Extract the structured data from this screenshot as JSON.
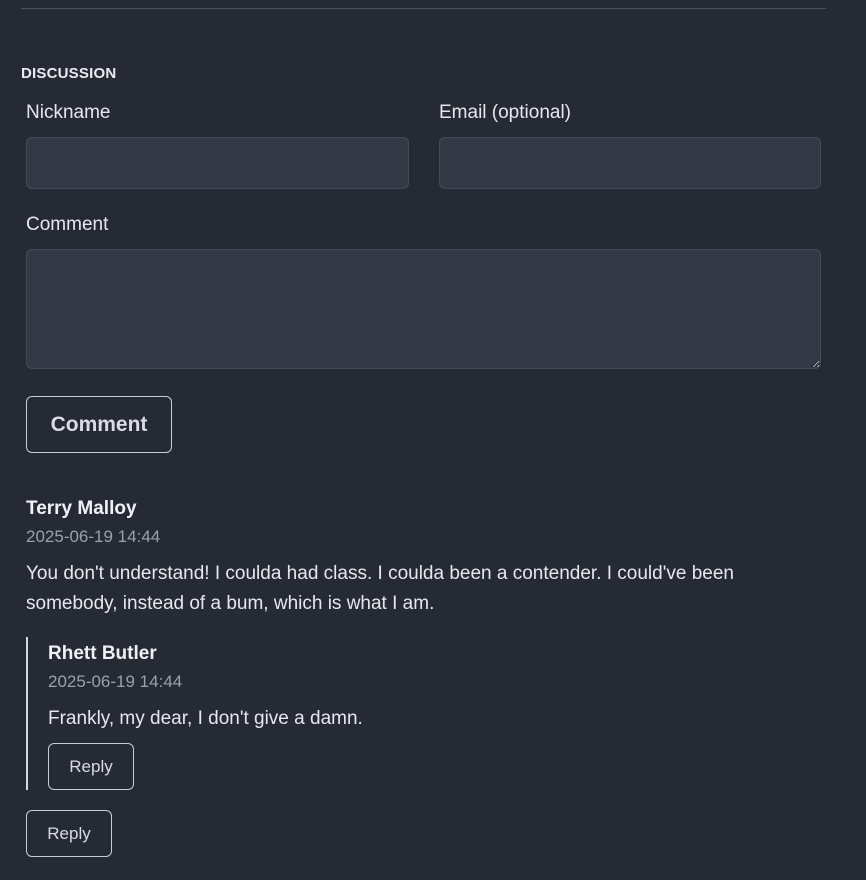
{
  "discussion": {
    "title": "DISCUSSION"
  },
  "form": {
    "nickname_label": "Nickname",
    "nickname_value": "",
    "nickname_placeholder": "",
    "email_label": "Email (optional)",
    "email_value": "",
    "email_placeholder": "",
    "comment_label": "Comment",
    "comment_value": "",
    "comment_placeholder": "",
    "submit_label": "Comment"
  },
  "comments": [
    {
      "author": "Terry Malloy",
      "timestamp": "2025-06-19 14:44",
      "text": "You don't understand! I coulda had class. I coulda been a contender. I could've been somebody, instead of a bum, which is what I am.",
      "reply_label": "Reply",
      "replies": [
        {
          "author": "Rhett Butler",
          "timestamp": "2025-06-19 14:44",
          "text": "Frankly, my dear, I don't give a damn.",
          "reply_label": "Reply"
        }
      ]
    }
  ],
  "colors": {
    "background": "#262a35",
    "input_background": "#343947",
    "text": "#e6e8ec",
    "muted_text": "#9aa0ac",
    "button_border": "#c9ccd3"
  }
}
